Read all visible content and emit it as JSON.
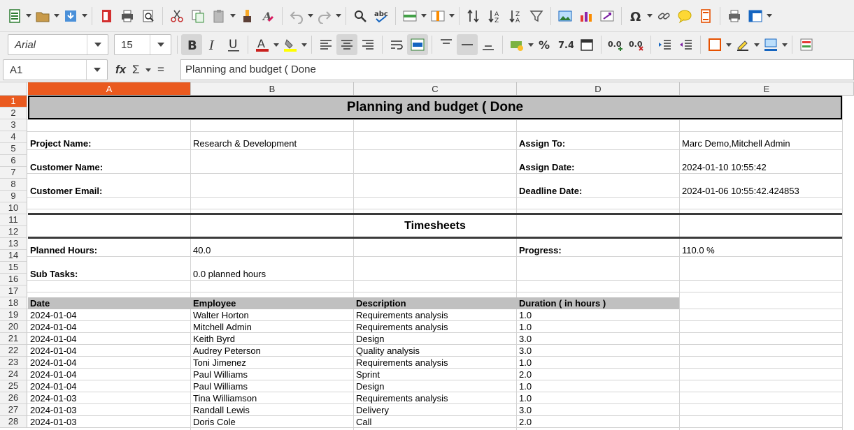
{
  "font": {
    "name": "Arial",
    "size": "15"
  },
  "name_box": "A1",
  "formula": "Planning and budget ( Done",
  "columns": [
    "A",
    "B",
    "C",
    "D",
    "E"
  ],
  "rows": [
    "1",
    "2",
    "3",
    "4",
    "5",
    "6",
    "7",
    "8",
    "9",
    "10",
    "11",
    "12",
    "13",
    "14",
    "15",
    "16",
    "17",
    "18",
    "19",
    "20",
    "21",
    "22",
    "23",
    "24",
    "25",
    "26",
    "27",
    "28"
  ],
  "sheet": {
    "title": "Planning and budget ( Done",
    "project_name_label": "Project Name:",
    "project_name": "Research & Development",
    "customer_name_label": "Customer Name:",
    "customer_name": "",
    "customer_email_label": "Customer Email:",
    "customer_email": "",
    "assign_to_label": "Assign To:",
    "assign_to": "Marc Demo,Mitchell Admin",
    "assign_date_label": "Assign Date:",
    "assign_date": "2024-01-10 10:55:42",
    "deadline_label": "Deadline Date:",
    "deadline": "2024-01-06 10:55:42.424853",
    "timesheets_title": "Timesheets",
    "planned_hours_label": "Planned Hours:",
    "planned_hours": "40.0",
    "progress_label": "Progress:",
    "progress": "110.0 %",
    "sub_tasks_label": "Sub Tasks:",
    "sub_tasks": "0.0 planned hours",
    "ts_headers": [
      "Date",
      "Employee",
      "Description",
      "Duration ( in hours )"
    ],
    "ts_rows": [
      [
        "2024-01-04",
        "Walter Horton",
        "Requirements analysis",
        "1.0"
      ],
      [
        "2024-01-04",
        "Mitchell Admin",
        "Requirements analysis",
        "1.0"
      ],
      [
        "2024-01-04",
        "Keith Byrd",
        "Design",
        "3.0"
      ],
      [
        "2024-01-04",
        "Audrey Peterson",
        "Quality analysis",
        "3.0"
      ],
      [
        "2024-01-04",
        "Toni Jimenez",
        "Requirements analysis",
        "1.0"
      ],
      [
        "2024-01-04",
        "Paul Williams",
        "Sprint",
        "2.0"
      ],
      [
        "2024-01-04",
        "Paul Williams",
        "Design",
        "1.0"
      ],
      [
        "2024-01-03",
        "Tina Williamson",
        "Requirements analysis",
        "1.0"
      ],
      [
        "2024-01-03",
        "Randall Lewis",
        "Delivery",
        "3.0"
      ],
      [
        "2024-01-03",
        "Doris Cole",
        "Call",
        "2.0"
      ]
    ]
  },
  "colors": {
    "selected_header": "#ea5a1f",
    "title_fill": "#c0c0c0",
    "header_fill": "#c0c0c0"
  }
}
